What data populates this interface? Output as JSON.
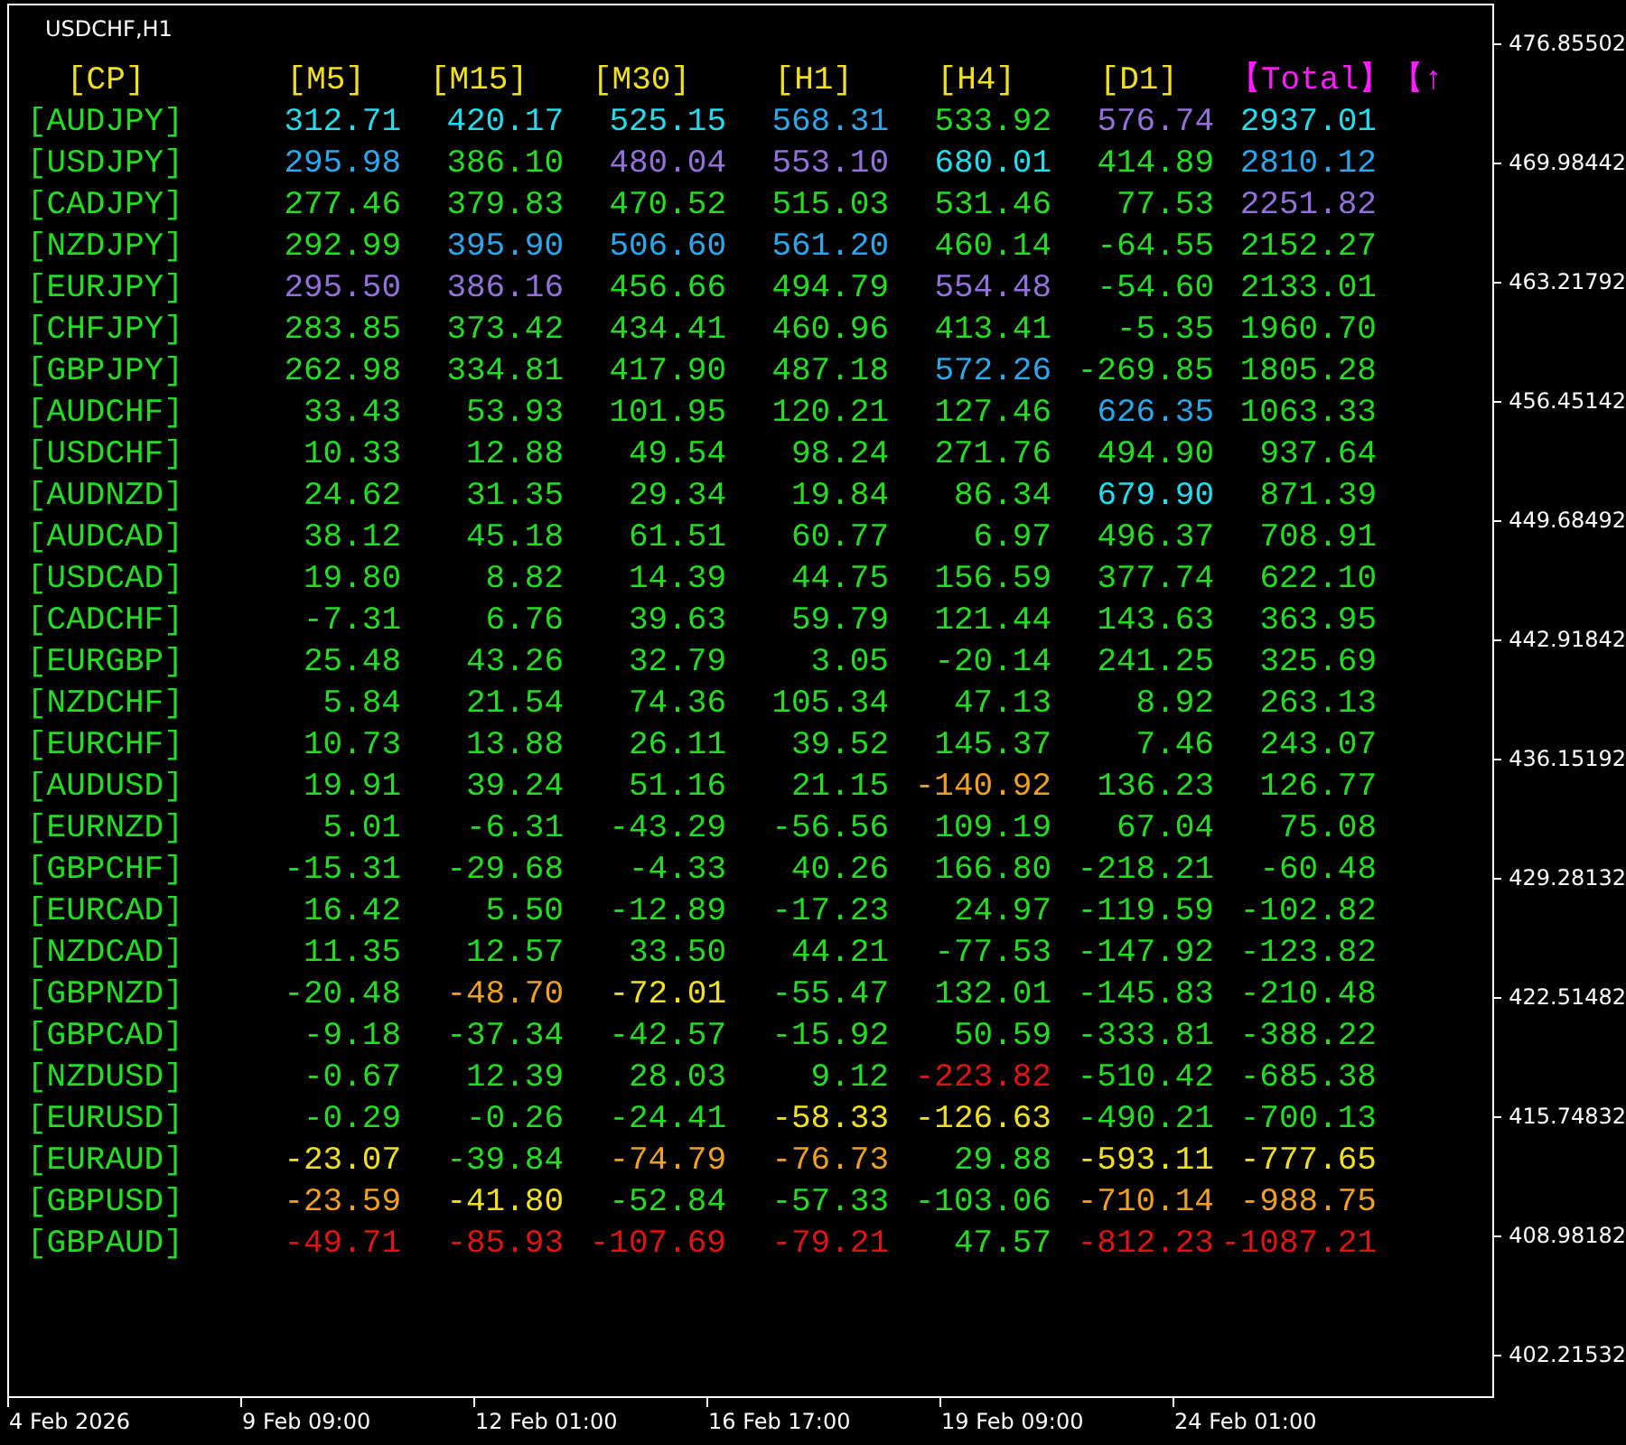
{
  "chart": {
    "title": "USDCHF,H1"
  },
  "table": {
    "columns": [
      {
        "label": "[CP]",
        "kind": "pair"
      },
      {
        "label": "[M5]",
        "kind": "timeframe"
      },
      {
        "label": "[M15]",
        "kind": "timeframe"
      },
      {
        "label": "[M30]",
        "kind": "timeframe"
      },
      {
        "label": "[H1]",
        "kind": "timeframe"
      },
      {
        "label": "[H4]",
        "kind": "timeframe"
      },
      {
        "label": "[D1]",
        "kind": "timeframe"
      },
      {
        "label": "【Total】【↑",
        "kind": "total"
      }
    ],
    "rows": [
      {
        "cells": [
          {
            "value": "[AUDJPY]",
            "color": "#22dd22"
          },
          {
            "value": "312.71",
            "color": "#22ddee"
          },
          {
            "value": "420.17",
            "color": "#22ddee"
          },
          {
            "value": "525.15",
            "color": "#22ddee"
          },
          {
            "value": "568.31",
            "color": "#2aa8ee"
          },
          {
            "value": "533.92",
            "color": "#22dd22"
          },
          {
            "value": "576.74",
            "color": "#9370db"
          },
          {
            "value": "2937.01",
            "color": "#22ddee"
          }
        ]
      },
      {
        "cells": [
          {
            "value": "[USDJPY]",
            "color": "#22dd22"
          },
          {
            "value": "295.98",
            "color": "#2aa8ee"
          },
          {
            "value": "386.10",
            "color": "#22dd22"
          },
          {
            "value": "480.04",
            "color": "#9370db"
          },
          {
            "value": "553.10",
            "color": "#9370db"
          },
          {
            "value": "680.01",
            "color": "#22ddee"
          },
          {
            "value": "414.89",
            "color": "#22dd22"
          },
          {
            "value": "2810.12",
            "color": "#2aa8ee"
          }
        ]
      },
      {
        "cells": [
          {
            "value": "[CADJPY]",
            "color": "#22dd22"
          },
          {
            "value": "277.46",
            "color": "#22dd22"
          },
          {
            "value": "379.83",
            "color": "#22dd22"
          },
          {
            "value": "470.52",
            "color": "#22dd22"
          },
          {
            "value": "515.03",
            "color": "#22dd22"
          },
          {
            "value": "531.46",
            "color": "#22dd22"
          },
          {
            "value": "77.53",
            "color": "#22dd22"
          },
          {
            "value": "2251.82",
            "color": "#9370db"
          }
        ]
      },
      {
        "cells": [
          {
            "value": "[NZDJPY]",
            "color": "#22dd22"
          },
          {
            "value": "292.99",
            "color": "#22dd22"
          },
          {
            "value": "395.90",
            "color": "#2aa8ee"
          },
          {
            "value": "506.60",
            "color": "#2aa8ee"
          },
          {
            "value": "561.20",
            "color": "#2aa8ee"
          },
          {
            "value": "460.14",
            "color": "#22dd22"
          },
          {
            "value": "-64.55",
            "color": "#22dd22"
          },
          {
            "value": "2152.27",
            "color": "#22dd22"
          }
        ]
      },
      {
        "cells": [
          {
            "value": "[EURJPY]",
            "color": "#22dd22"
          },
          {
            "value": "295.50",
            "color": "#9370db"
          },
          {
            "value": "386.16",
            "color": "#9370db"
          },
          {
            "value": "456.66",
            "color": "#22dd22"
          },
          {
            "value": "494.79",
            "color": "#22dd22"
          },
          {
            "value": "554.48",
            "color": "#9370db"
          },
          {
            "value": "-54.60",
            "color": "#22dd22"
          },
          {
            "value": "2133.01",
            "color": "#22dd22"
          }
        ]
      },
      {
        "cells": [
          {
            "value": "[CHFJPY]",
            "color": "#22dd22"
          },
          {
            "value": "283.85",
            "color": "#22dd22"
          },
          {
            "value": "373.42",
            "color": "#22dd22"
          },
          {
            "value": "434.41",
            "color": "#22dd22"
          },
          {
            "value": "460.96",
            "color": "#22dd22"
          },
          {
            "value": "413.41",
            "color": "#22dd22"
          },
          {
            "value": "-5.35",
            "color": "#22dd22"
          },
          {
            "value": "1960.70",
            "color": "#22dd22"
          }
        ]
      },
      {
        "cells": [
          {
            "value": "[GBPJPY]",
            "color": "#22dd22"
          },
          {
            "value": "262.98",
            "color": "#22dd22"
          },
          {
            "value": "334.81",
            "color": "#22dd22"
          },
          {
            "value": "417.90",
            "color": "#22dd22"
          },
          {
            "value": "487.18",
            "color": "#22dd22"
          },
          {
            "value": "572.26",
            "color": "#2aa8ee"
          },
          {
            "value": "-269.85",
            "color": "#22dd22"
          },
          {
            "value": "1805.28",
            "color": "#22dd22"
          }
        ]
      },
      {
        "cells": [
          {
            "value": "[AUDCHF]",
            "color": "#22dd22"
          },
          {
            "value": "33.43",
            "color": "#22dd22"
          },
          {
            "value": "53.93",
            "color": "#22dd22"
          },
          {
            "value": "101.95",
            "color": "#22dd22"
          },
          {
            "value": "120.21",
            "color": "#22dd22"
          },
          {
            "value": "127.46",
            "color": "#22dd22"
          },
          {
            "value": "626.35",
            "color": "#2aa8ee"
          },
          {
            "value": "1063.33",
            "color": "#22dd22"
          }
        ]
      },
      {
        "cells": [
          {
            "value": "[USDCHF]",
            "color": "#22dd22"
          },
          {
            "value": "10.33",
            "color": "#22dd22"
          },
          {
            "value": "12.88",
            "color": "#22dd22"
          },
          {
            "value": "49.54",
            "color": "#22dd22"
          },
          {
            "value": "98.24",
            "color": "#22dd22"
          },
          {
            "value": "271.76",
            "color": "#22dd22"
          },
          {
            "value": "494.90",
            "color": "#22dd22"
          },
          {
            "value": "937.64",
            "color": "#22dd22"
          }
        ]
      },
      {
        "cells": [
          {
            "value": "[AUDNZD]",
            "color": "#22dd22"
          },
          {
            "value": "24.62",
            "color": "#22dd22"
          },
          {
            "value": "31.35",
            "color": "#22dd22"
          },
          {
            "value": "29.34",
            "color": "#22dd22"
          },
          {
            "value": "19.84",
            "color": "#22dd22"
          },
          {
            "value": "86.34",
            "color": "#22dd22"
          },
          {
            "value": "679.90",
            "color": "#22ddee"
          },
          {
            "value": "871.39",
            "color": "#22dd22"
          }
        ]
      },
      {
        "cells": [
          {
            "value": "[AUDCAD]",
            "color": "#22dd22"
          },
          {
            "value": "38.12",
            "color": "#22dd22"
          },
          {
            "value": "45.18",
            "color": "#22dd22"
          },
          {
            "value": "61.51",
            "color": "#22dd22"
          },
          {
            "value": "60.77",
            "color": "#22dd22"
          },
          {
            "value": "6.97",
            "color": "#22dd22"
          },
          {
            "value": "496.37",
            "color": "#22dd22"
          },
          {
            "value": "708.91",
            "color": "#22dd22"
          }
        ]
      },
      {
        "cells": [
          {
            "value": "[USDCAD]",
            "color": "#22dd22"
          },
          {
            "value": "19.80",
            "color": "#22dd22"
          },
          {
            "value": "8.82",
            "color": "#22dd22"
          },
          {
            "value": "14.39",
            "color": "#22dd22"
          },
          {
            "value": "44.75",
            "color": "#22dd22"
          },
          {
            "value": "156.59",
            "color": "#22dd22"
          },
          {
            "value": "377.74",
            "color": "#22dd22"
          },
          {
            "value": "622.10",
            "color": "#22dd22"
          }
        ]
      },
      {
        "cells": [
          {
            "value": "[CADCHF]",
            "color": "#22dd22"
          },
          {
            "value": "-7.31",
            "color": "#22dd22"
          },
          {
            "value": "6.76",
            "color": "#22dd22"
          },
          {
            "value": "39.63",
            "color": "#22dd22"
          },
          {
            "value": "59.79",
            "color": "#22dd22"
          },
          {
            "value": "121.44",
            "color": "#22dd22"
          },
          {
            "value": "143.63",
            "color": "#22dd22"
          },
          {
            "value": "363.95",
            "color": "#22dd22"
          }
        ]
      },
      {
        "cells": [
          {
            "value": "[EURGBP]",
            "color": "#22dd22"
          },
          {
            "value": "25.48",
            "color": "#22dd22"
          },
          {
            "value": "43.26",
            "color": "#22dd22"
          },
          {
            "value": "32.79",
            "color": "#22dd22"
          },
          {
            "value": "3.05",
            "color": "#22dd22"
          },
          {
            "value": "-20.14",
            "color": "#22dd22"
          },
          {
            "value": "241.25",
            "color": "#22dd22"
          },
          {
            "value": "325.69",
            "color": "#22dd22"
          }
        ]
      },
      {
        "cells": [
          {
            "value": "[NZDCHF]",
            "color": "#22dd22"
          },
          {
            "value": "5.84",
            "color": "#22dd22"
          },
          {
            "value": "21.54",
            "color": "#22dd22"
          },
          {
            "value": "74.36",
            "color": "#22dd22"
          },
          {
            "value": "105.34",
            "color": "#22dd22"
          },
          {
            "value": "47.13",
            "color": "#22dd22"
          },
          {
            "value": "8.92",
            "color": "#22dd22"
          },
          {
            "value": "263.13",
            "color": "#22dd22"
          }
        ]
      },
      {
        "cells": [
          {
            "value": "[EURCHF]",
            "color": "#22dd22"
          },
          {
            "value": "10.73",
            "color": "#22dd22"
          },
          {
            "value": "13.88",
            "color": "#22dd22"
          },
          {
            "value": "26.11",
            "color": "#22dd22"
          },
          {
            "value": "39.52",
            "color": "#22dd22"
          },
          {
            "value": "145.37",
            "color": "#22dd22"
          },
          {
            "value": "7.46",
            "color": "#22dd22"
          },
          {
            "value": "243.07",
            "color": "#22dd22"
          }
        ]
      },
      {
        "cells": [
          {
            "value": "[AUDUSD]",
            "color": "#22dd22"
          },
          {
            "value": "19.91",
            "color": "#22dd22"
          },
          {
            "value": "39.24",
            "color": "#22dd22"
          },
          {
            "value": "51.16",
            "color": "#22dd22"
          },
          {
            "value": "21.15",
            "color": "#22dd22"
          },
          {
            "value": "-140.92",
            "color": "#f0a020"
          },
          {
            "value": "136.23",
            "color": "#22dd22"
          },
          {
            "value": "126.77",
            "color": "#22dd22"
          }
        ]
      },
      {
        "cells": [
          {
            "value": "[EURNZD]",
            "color": "#22dd22"
          },
          {
            "value": "5.01",
            "color": "#22dd22"
          },
          {
            "value": "-6.31",
            "color": "#22dd22"
          },
          {
            "value": "-43.29",
            "color": "#22dd22"
          },
          {
            "value": "-56.56",
            "color": "#22dd22"
          },
          {
            "value": "109.19",
            "color": "#22dd22"
          },
          {
            "value": "67.04",
            "color": "#22dd22"
          },
          {
            "value": "75.08",
            "color": "#22dd22"
          }
        ]
      },
      {
        "cells": [
          {
            "value": "[GBPCHF]",
            "color": "#22dd22"
          },
          {
            "value": "-15.31",
            "color": "#22dd22"
          },
          {
            "value": "-29.68",
            "color": "#22dd22"
          },
          {
            "value": "-4.33",
            "color": "#22dd22"
          },
          {
            "value": "40.26",
            "color": "#22dd22"
          },
          {
            "value": "166.80",
            "color": "#22dd22"
          },
          {
            "value": "-218.21",
            "color": "#22dd22"
          },
          {
            "value": "-60.48",
            "color": "#22dd22"
          }
        ]
      },
      {
        "cells": [
          {
            "value": "[EURCAD]",
            "color": "#22dd22"
          },
          {
            "value": "16.42",
            "color": "#22dd22"
          },
          {
            "value": "5.50",
            "color": "#22dd22"
          },
          {
            "value": "-12.89",
            "color": "#22dd22"
          },
          {
            "value": "-17.23",
            "color": "#22dd22"
          },
          {
            "value": "24.97",
            "color": "#22dd22"
          },
          {
            "value": "-119.59",
            "color": "#22dd22"
          },
          {
            "value": "-102.82",
            "color": "#22dd22"
          }
        ]
      },
      {
        "cells": [
          {
            "value": "[NZDCAD]",
            "color": "#22dd22"
          },
          {
            "value": "11.35",
            "color": "#22dd22"
          },
          {
            "value": "12.57",
            "color": "#22dd22"
          },
          {
            "value": "33.50",
            "color": "#22dd22"
          },
          {
            "value": "44.21",
            "color": "#22dd22"
          },
          {
            "value": "-77.53",
            "color": "#22dd22"
          },
          {
            "value": "-147.92",
            "color": "#22dd22"
          },
          {
            "value": "-123.82",
            "color": "#22dd22"
          }
        ]
      },
      {
        "cells": [
          {
            "value": "[GBPNZD]",
            "color": "#22dd22"
          },
          {
            "value": "-20.48",
            "color": "#22dd22"
          },
          {
            "value": "-48.70",
            "color": "#f0a020"
          },
          {
            "value": "-72.01",
            "color": "#f2e01e"
          },
          {
            "value": "-55.47",
            "color": "#22dd22"
          },
          {
            "value": "132.01",
            "color": "#22dd22"
          },
          {
            "value": "-145.83",
            "color": "#22dd22"
          },
          {
            "value": "-210.48",
            "color": "#22dd22"
          }
        ]
      },
      {
        "cells": [
          {
            "value": "[GBPCAD]",
            "color": "#22dd22"
          },
          {
            "value": "-9.18",
            "color": "#22dd22"
          },
          {
            "value": "-37.34",
            "color": "#22dd22"
          },
          {
            "value": "-42.57",
            "color": "#22dd22"
          },
          {
            "value": "-15.92",
            "color": "#22dd22"
          },
          {
            "value": "50.59",
            "color": "#22dd22"
          },
          {
            "value": "-333.81",
            "color": "#22dd22"
          },
          {
            "value": "-388.22",
            "color": "#22dd22"
          }
        ]
      },
      {
        "cells": [
          {
            "value": "[NZDUSD]",
            "color": "#22dd22"
          },
          {
            "value": "-0.67",
            "color": "#22dd22"
          },
          {
            "value": "12.39",
            "color": "#22dd22"
          },
          {
            "value": "28.03",
            "color": "#22dd22"
          },
          {
            "value": "9.12",
            "color": "#22dd22"
          },
          {
            "value": "-223.82",
            "color": "#e01414"
          },
          {
            "value": "-510.42",
            "color": "#22dd22"
          },
          {
            "value": "-685.38",
            "color": "#22dd22"
          }
        ]
      },
      {
        "cells": [
          {
            "value": "[EURUSD]",
            "color": "#22dd22"
          },
          {
            "value": "-0.29",
            "color": "#22dd22"
          },
          {
            "value": "-0.26",
            "color": "#22dd22"
          },
          {
            "value": "-24.41",
            "color": "#22dd22"
          },
          {
            "value": "-58.33",
            "color": "#f2e01e"
          },
          {
            "value": "-126.63",
            "color": "#f2e01e"
          },
          {
            "value": "-490.21",
            "color": "#22dd22"
          },
          {
            "value": "-700.13",
            "color": "#22dd22"
          }
        ]
      },
      {
        "cells": [
          {
            "value": "[EURAUD]",
            "color": "#22dd22"
          },
          {
            "value": "-23.07",
            "color": "#f2e01e"
          },
          {
            "value": "-39.84",
            "color": "#22dd22"
          },
          {
            "value": "-74.79",
            "color": "#f0a020"
          },
          {
            "value": "-76.73",
            "color": "#f0a020"
          },
          {
            "value": "29.88",
            "color": "#22dd22"
          },
          {
            "value": "-593.11",
            "color": "#f2e01e"
          },
          {
            "value": "-777.65",
            "color": "#f2e01e"
          }
        ]
      },
      {
        "cells": [
          {
            "value": "[GBPUSD]",
            "color": "#22dd22"
          },
          {
            "value": "-23.59",
            "color": "#f0a020"
          },
          {
            "value": "-41.80",
            "color": "#f2e01e"
          },
          {
            "value": "-52.84",
            "color": "#22dd22"
          },
          {
            "value": "-57.33",
            "color": "#22dd22"
          },
          {
            "value": "-103.06",
            "color": "#22dd22"
          },
          {
            "value": "-710.14",
            "color": "#f0a020"
          },
          {
            "value": "-988.75",
            "color": "#f0a020"
          }
        ]
      },
      {
        "cells": [
          {
            "value": "[GBPAUD]",
            "color": "#22dd22"
          },
          {
            "value": "-49.71",
            "color": "#e01414"
          },
          {
            "value": "-85.93",
            "color": "#e01414"
          },
          {
            "value": "-107.69",
            "color": "#e01414"
          },
          {
            "value": "-79.21",
            "color": "#e01414"
          },
          {
            "value": "47.57",
            "color": "#22dd22"
          },
          {
            "value": "-812.23",
            "color": "#e01414"
          },
          {
            "value": "-1087.21",
            "color": "#e01414"
          }
        ]
      }
    ]
  },
  "price_axis": [
    "476.85502",
    "469.98442",
    "463.21792",
    "456.45142",
    "449.68492",
    "442.91842",
    "436.15192",
    "429.28132",
    "422.51482",
    "415.74832",
    "408.98182",
    "402.21532"
  ],
  "time_axis": [
    "4 Feb 2026",
    "9 Feb 09:00",
    "12 Feb 01:00",
    "16 Feb 17:00",
    "19 Feb 09:00",
    "24 Feb 01:00"
  ]
}
